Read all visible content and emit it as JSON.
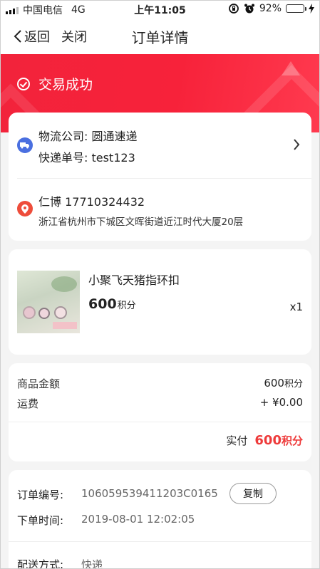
{
  "status_bar": {
    "carrier": "中国电信",
    "network": "4G",
    "time": "上午11:05",
    "battery": "92%"
  },
  "nav": {
    "back_label": "返回",
    "close_label": "关闭",
    "title": "订单详情"
  },
  "order_status": {
    "text": "交易成功"
  },
  "shipping": {
    "company": "物流公司: 圆通速递",
    "tracking": "快递单号: test123"
  },
  "address": {
    "name_phone": "仁博 17710324432",
    "detail": "浙江省杭州市下城区文晖街道近江时代大厦20层"
  },
  "product": {
    "name": "小聚飞天猪指环扣",
    "price": "600",
    "price_unit": "积分",
    "quantity": "x1"
  },
  "amount": {
    "goods_label": "商品金额",
    "goods_value": "600",
    "goods_unit": "积分",
    "freight_label": "运费",
    "freight_value": "+ ¥0.00",
    "paid_label": "实付",
    "paid_value": "600",
    "paid_unit": "积分"
  },
  "order_info": {
    "number_label": "订单编号:",
    "number_value": "106059539411203C0165",
    "copy_label": "复制",
    "time_label": "下单时间:",
    "time_value": "2019-08-01 12:02:05",
    "delivery_label": "配送方式:",
    "delivery_value": "快递"
  },
  "colors": {
    "banner": "#f2233b",
    "accent_red": "#ee3b3b",
    "truck_icon_bg": "#4a6fe0",
    "pin_icon_bg": "#ee4d3b",
    "battery_green": "#3cc94a"
  },
  "battery_level": 0.92
}
